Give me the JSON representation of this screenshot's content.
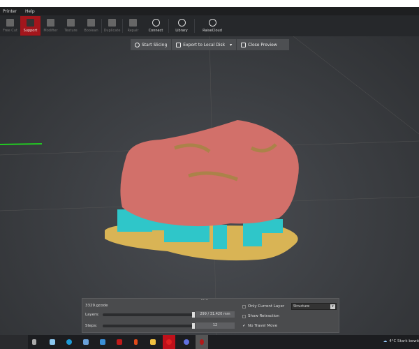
{
  "menu": [
    "Printer",
    "Help"
  ],
  "toolbar": [
    {
      "label": "Free Cut",
      "state": "disabled"
    },
    {
      "label": "Support",
      "state": "active"
    },
    {
      "label": "Modifier",
      "state": "disabled"
    },
    {
      "label": "Texture",
      "state": "disabled"
    },
    {
      "label": "Boolean",
      "state": "disabled"
    },
    {
      "label": "Duplicate",
      "state": "disabled"
    },
    {
      "label": "Repair",
      "state": "disabled"
    },
    {
      "label": "Connect",
      "state": "enabled"
    },
    {
      "label": "Library",
      "state": "enabled"
    },
    {
      "label": "RaiseCloud",
      "state": "enabled"
    }
  ],
  "actions": {
    "start": "Start Slicing",
    "export": "Export to Local Disk",
    "close": "Close Preview"
  },
  "panel": {
    "filename": "3329.gcode",
    "layers_label": "Layers:",
    "layers_value": "299 / 31.420 mm",
    "layers_fraction": 1.0,
    "steps_label": "Steps:",
    "steps_value": "12",
    "steps_fraction": 1.0,
    "only_current_layer": {
      "label": "Only Current Layer",
      "checked": false
    },
    "show_retraction": {
      "label": "Show Retraction",
      "checked": false
    },
    "no_travel_move": {
      "label": "No Travel Move",
      "checked": true
    },
    "view_mode": "Structure"
  },
  "taskbar": {
    "weather": "4°C  Stark bewö",
    "apps": [
      "task-view",
      "onedrive",
      "edge",
      "store",
      "mail",
      "game",
      "office",
      "explorer",
      "opera",
      "chat",
      "raise3d"
    ]
  },
  "colors": {
    "accent": "#a3161c",
    "model": "#d2706a",
    "support": "#2fc6c9",
    "raft": "#d9b455"
  }
}
